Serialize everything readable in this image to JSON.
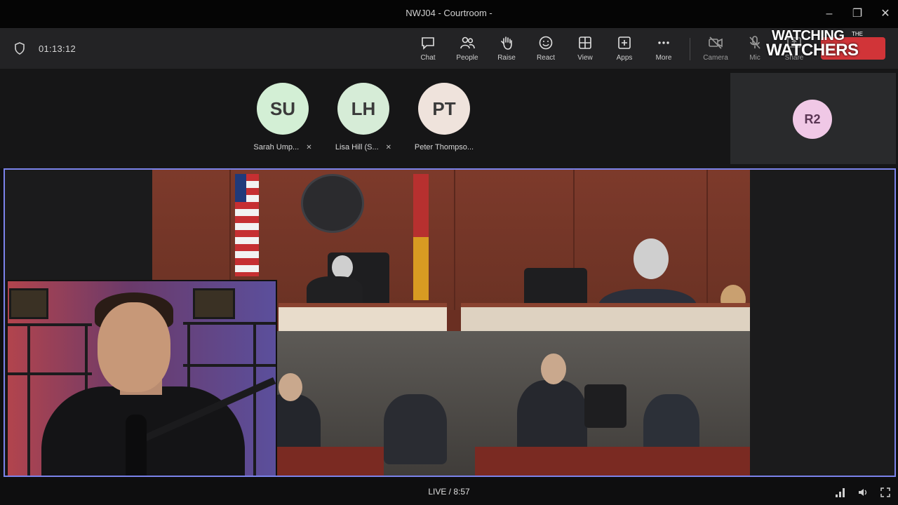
{
  "window": {
    "title": "NWJ04 - Courtroom -",
    "controls": {
      "minimize": "–",
      "restore": "❐",
      "close": "✕"
    }
  },
  "meeting": {
    "timer": "01:13:12"
  },
  "toolbar": {
    "chat": "Chat",
    "people": "People",
    "raise": "Raise",
    "react": "React",
    "view": "View",
    "apps": "Apps",
    "more": "More",
    "camera": "Camera",
    "mic": "Mic",
    "share": "Share"
  },
  "overlay": {
    "brand_line1": "WATCHING",
    "brand_of": "THE",
    "brand_line2": "WATCHERS"
  },
  "participants": [
    {
      "initials": "SU",
      "name": "Sarah Ump...",
      "color": "#d3efd5"
    },
    {
      "initials": "LH",
      "name": "Lisa Hill (S...",
      "color": "#d6ecd7"
    },
    {
      "initials": "PT",
      "name": "Peter Thompso...",
      "color": "#efe3dc"
    }
  ],
  "side_tile": {
    "initials": "R2",
    "color": "#f0c8e6"
  },
  "player": {
    "live_label": "LIVE / 8:57"
  },
  "colors": {
    "active_border": "#7b83eb",
    "leave_red": "#d13438"
  }
}
